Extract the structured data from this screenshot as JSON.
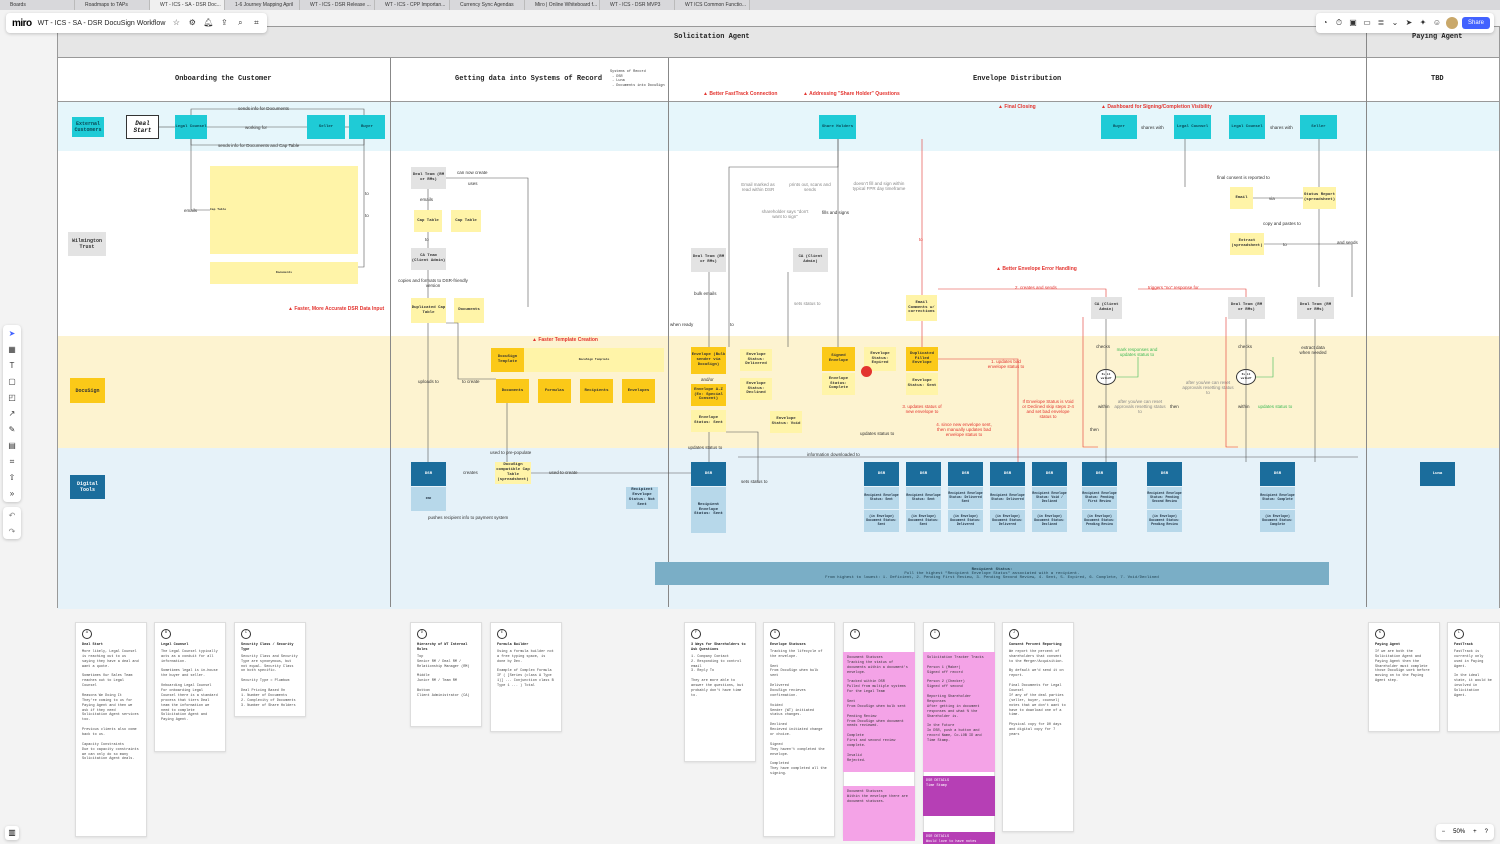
{
  "browser_tabs": [
    "Boards",
    "Roadmaps to TAPs",
    "WT - ICS - SA - DSR Doc...",
    "1-6 Journey Mapping April",
    "WT - ICS - DSR Release ...",
    "WT - ICS - CPP Importan...",
    "Currency Sync Agendas",
    "Miro | Online Whiteboard f...",
    "WT - ICS - DSR MVP3",
    "WT ICS Common Functio..."
  ],
  "topbar": {
    "logo": "miro",
    "board_title": "WT - ICS - SA - DSR DocuSign Workflow",
    "share_label": "Share"
  },
  "zoom": {
    "level": "50%",
    "minus": "−",
    "plus": "+"
  },
  "header": {
    "solicitation_agent": "Solicitation Agent",
    "paying_agent": "Paying Agent"
  },
  "sections": {
    "onboarding": "Onboarding the Customer",
    "getting_data": "Getting data into Systems of Record",
    "systems_of_record_note": "Systems of Record\n - DSR\n - Luna\n - Documents into DocuSign",
    "envelope": "Envelope Distribution",
    "tbd": "TBD"
  },
  "lanes": {
    "wilmington": "Wilmington Trust",
    "docusign": "DocuSign",
    "digital": "Digital Tools"
  },
  "cards": {
    "external": "External Customers",
    "deal_start": "Deal Start",
    "legal_counsel": "Legal Counsel",
    "seller": "Seller",
    "buyer": "Buyer",
    "share_holders": "Share Holders",
    "buyer2": "Buyer",
    "legal2": "Legal Counsel",
    "legal3": "Legal Counsel",
    "seller2": "Seller",
    "deal_team": "Deal Team (RM or RMs)",
    "cap_table": "Cap Table",
    "ca_team": "CA Team (Client Admin)",
    "dup_cap": "Duplicated Cap Table",
    "documents_small": "Documents",
    "deal_team2": "Deal Team (RM or RMs)",
    "ca2": "CA (Client Admin)",
    "email_comments": "Email Comments w/ corrections",
    "email": "Email",
    "status_report": "Status Report (spreadsheet)",
    "extract": "Extract (spreadsheet)",
    "ca3": "CA (Client Admin)",
    "deal_team3": "Deal Team (RM or RMs)",
    "deal_team4": "Deal Team (RM or RMs)",
    "docusign_template": "DocuSign Template",
    "documents": "Documents",
    "formulas": "Formulas",
    "recipients": "Recipients",
    "envelopes": "Envelopes",
    "envelope_bulk": "Envelope (Bulk sender via DocuSign)",
    "and_or": "and/or",
    "envelope_special": "Envelope A-Z (Ex: Special Consent)",
    "env_sent": "Envelope Status: Sent",
    "env_delivered": "Envelope Status: Delivered",
    "env_declined": "Envelope Status: Declined",
    "env_void": "Envelope Status: Void",
    "signed_env": "Signed Envelope",
    "env_complete": "Envelope Status: Complete",
    "env_expired": "Envelope Status: Expired",
    "dup_filled": "Duplicated Filled Envelope",
    "env_sent2": "Envelope Status: Sent",
    "dsr": "DSR",
    "docusign_cap": "DocuSign compatible Cap Table (spreadsheet)",
    "luna": "Luna",
    "recip_not_sent": "Recipient Envelope Status: Not Sent"
  },
  "dsr_cols": [
    {
      "status": "Recipient Envelope Status: Sent",
      "sub": "(in Envelope) Document Status: Sent"
    },
    {
      "status": "Recipient Envelope Status: Sent",
      "sub": "(in Envelope) Document Status: Sent"
    },
    {
      "status": "Recipient Envelope Status: Sent",
      "sub": "(in Envelope) Document Status: Sent"
    },
    {
      "status": "Recipient Envelope Status: Delivered Sent",
      "sub": "(in Envelope) Document Status: Delivered"
    },
    {
      "status": "Recipient Envelope Status: Delivered",
      "sub": "(in Envelope) Document Status: Delivered"
    },
    {
      "status": "Recipient Envelope Status: Void / Declined",
      "sub": "(in Envelope) Document Status: Declined"
    },
    {
      "status": "Recipient Envelope Status: Pending First Review",
      "sub": "(in Envelope) Document Status: Pending Review"
    },
    {
      "status": "Recipient Envelope Status: Pending Second Review",
      "sub": "(in Envelope) Document Status: Pending Review"
    },
    {
      "status": "Recipient Envelope Status: Complete",
      "sub": "(in Envelope) Document Status: Complete"
    }
  ],
  "recipient_status": {
    "title": "Recipient Status:",
    "line1": "Pull the highest \"Recipient Envelope Status\" associated with a recipient.",
    "line2": "From highest to lowest: 1. Deficient, 2. Pending First Review, 3. Pending Second Review, 4. Sent, 5. Expired, 6. Complete, 7. Void/Declined"
  },
  "warnings": {
    "faster_dsr": "Faster, More Accurate DSR Data Input",
    "faster_template": "Faster Template Creation",
    "better_fasttrack": "Better FastTrack Connection",
    "share_holder_q": "Addressing \"Share Holder\" Questions",
    "final_closing": "Final Closing",
    "dashboard": "Dashboard for Signing/Completion Visibility",
    "error_handling": "Better Envelope Error Handling"
  },
  "annotations": {
    "sends_info": "sends info for Documents",
    "working_for": "working for",
    "sends_info_cap": "sends info for Documents and Cap Table",
    "emails": "emails",
    "to": "to",
    "can_now_create": "can now create",
    "uses": "uses",
    "copies": "copies and formats to DSR-friendly version",
    "uploads_to": "uploads to",
    "to_create": "to create",
    "used_prepopulate": "used to pre-populate",
    "creates": "creates",
    "used_to_create": "used to create",
    "pushes": "pushes recipient info to payment system",
    "email_marked": "Email marked as read within DSR",
    "prints_scans": "prints out, scans and sends",
    "doesnt_fill": "doesn't fill and sign within typical FPR day timeframe",
    "shareholder_says": "shareholder says \"don't want to sign\"",
    "fills_signs": "fills and signs",
    "bulk_emails": "bulk emails",
    "sets_status": "sets status to",
    "when_ready": "when ready",
    "updates_status": "updates status to",
    "sets_status2": "sets status to",
    "info_downloaded": "information downloaded to",
    "updates_status2": "updates status to",
    "creates_sends": "2. creates and sends",
    "triggers_no": "triggers \"no\" response for",
    "checks": "checks",
    "yes": "yes",
    "no": "no",
    "mark_responses": "mark responses and updates status to",
    "updates_bad": "1. updates bad envelope status to",
    "updates_status_new": "3. updates status of new envelope to",
    "since_new": "4. since new envelope sent, then manually updates bad envelope status to",
    "if_void": "If Envelope Status is Void or Declined skip steps 2-4 and set bad envelope status to",
    "after_you": "after you/we can reset approvals resetting status to",
    "within": "within",
    "then": "then",
    "extract_data": "extract data when needed",
    "final_consent": "final consent is reported to",
    "via": "via",
    "copy_paste": "copy and pastes to",
    "and_sends": "and sends",
    "shares_with": "shares with",
    "to_red": "to",
    "is_it_valid": "Is it valid?"
  },
  "notes": [
    {
      "badge": "A",
      "title": "Deal Start",
      "body": "More likely, Legal Counsel is reaching out to us saying they have a deal and want a quote.\n\nSometimes Our Sales Team reaches out to Legal Counsel\n\nReasons We Doing It\nThey're coming to us for Paying Agent and then we ask if they need Solicitation Agent services too.\n\nPrevious clients also come back to us.\n\nCapacity Constraints\nDue to capacity constraints we can only do so many Solicitation Agent deals."
    },
    {
      "badge": "B",
      "title": "Legal Counsel",
      "body": "The Legal Counsel typically acts as a conduit for all information.\n\nSometimes legal is in-house the buyer and seller.\n\nOnboarding Legal Counsel\nFor onboarding Legal Counsel there is a standard process that tiers Deal team the information we need to complete Solicitation Agent and Paying Agent."
    },
    {
      "badge": "C",
      "title": "Security Class / Security Type",
      "body": "Security Class and Security Type are synonymous, but not equal. Security Class on both specific.\n\nSecurity Type = Plumbum\n\nDeal Pricing Based On\n1. Number of Documents\n2. Complexity of Documents\n3. Number of Share Holders"
    },
    {
      "badge": "D",
      "title": "Hierarchy of WT Internal Roles",
      "body": "Top\nSenior RM / Deal RM / Relationship Manager (RM)\n\nMiddle\nJunior RM / Team RM\n\nBottom\nClient Administrator (CA)"
    },
    {
      "badge": "E",
      "title": "Formula Builder",
      "body": "Using a formula builder not a free typing space, is done by Dev.\n\nExample of Complex Formula\nIF ( [Series (class A Type 1)] ... Conjunction class B Type 1 ... ) Total"
    },
    {
      "badge": "F",
      "title": "3 Ways for Shareholders to Ask Questions",
      "body": "1. Company Contact\n2. Responding to control email\n3. Reply To\n\nThey are more able to answer the questions, but probably don't have time to."
    },
    {
      "badge": "G",
      "title": "Envelope Statuses",
      "body": "Tracking the lifecycle of the envelope.\n\nSent\nFrom DocuSign when bulk sent\n\nDelivered\nDocuSign recieves confirmation.\n\nVoided\nSender (WT) initiated status changes.\n\nDeclined\nRecieved initiated change or choice.\n\nSigned\nThey haven't completed the envelope.\n\nCompleted\nThey have completed all the signing."
    },
    {
      "badge": "H",
      "title": "",
      "body": ""
    },
    {
      "badge": "I",
      "title": "",
      "body": ""
    },
    {
      "badge": "J",
      "title": "Consent Percent Reporting",
      "body": "We report the percent of shareholders that consent to the Merger/Acquisition.\n\nBy default we'd send it on report.\n\nFinal Documents for Legal Counsel\nIf any of the deal parties (seller, buyer, counsel) notes that we don't want to have to download one of a time.\n\nPhysical copy for 90 days and digital copy for 7 years"
    },
    {
      "badge": "K",
      "title": "Paying Agent",
      "body": "If we are both the Solicitation Agent and Paying Agent then the Shareholder must complete those DocuSign work before moving on to the Paying Agent step."
    },
    {
      "badge": "L",
      "title": "FastTrack",
      "body": "FastTrack is currently only used in Paying Agent.\n\nIn the ideal state, it would be involved in Solicitation Agent."
    }
  ],
  "pink_notes": {
    "h": "Document Statuses\nTracking the status of documents within a document's envelope.\n\nTracked within DSR\nPulled from multiple systems\nFor the Legal Team\n\nSent\nFrom DocuSign when bulk sent\n\nPending Review\nFrom DocuSign when document needs reviewed.\n\nComplete\nFirst and second review complete.\n\nInvalid\nRejected.",
    "i": "Solicitation Tracker Tracks\n\nPerson 1 (Maker)\nSigned off record\n\nPerson 2 (Checker)\nSigned off second\n\nReporting Shareholder Responses\nAfter getting in document responses and what % the Shareholder is.\n\nIn the Future\nIn DSR, push a button and record Name, Co-LOB ID and Time Stamp.",
    "h2": "Document Statuses\nWithin the envelope there are document statuses.",
    "purple1": "DSR DETAILS\nTime Stamp",
    "purple2": "DSR DETAILS\nWould love to have notes feature"
  }
}
